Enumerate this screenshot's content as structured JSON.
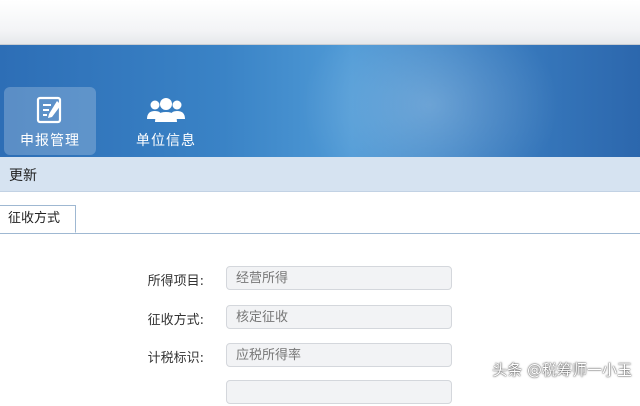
{
  "nav": {
    "items": [
      {
        "label": "申报管理",
        "icon": "edit-document-icon",
        "active": true
      },
      {
        "label": "单位信息",
        "icon": "users-icon",
        "active": false
      }
    ]
  },
  "toolbar": {
    "update_label": "更新"
  },
  "tabs": [
    {
      "label": "征收方式",
      "active": true
    }
  ],
  "form": {
    "rows": [
      {
        "label": "所得项目:",
        "value": "经营所得"
      },
      {
        "label": "征收方式:",
        "value": "核定征收"
      },
      {
        "label": "计税标识:",
        "value": "应税所得率"
      }
    ]
  },
  "watermark": {
    "text": "头条 @税筹师一小玉"
  },
  "colors": {
    "banner": "#3a83c6",
    "toolbar": "#d6e3f1",
    "field_bg": "#f2f3f5"
  }
}
